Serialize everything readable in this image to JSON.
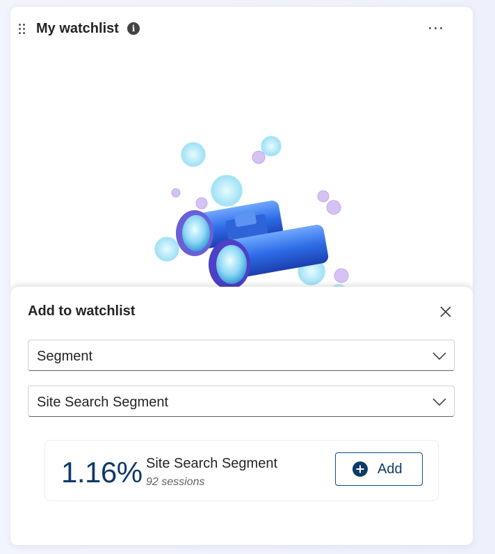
{
  "widget": {
    "title": "My watchlist",
    "info_icon": "info-icon",
    "more_icon": "more-horizontal-icon",
    "drag_icon": "drag-grip-icon",
    "illustration": "binoculars-snowflakes-illustration"
  },
  "panel": {
    "title": "Add to watchlist",
    "close_icon": "close-icon",
    "type_select": {
      "value": "Segment",
      "icon": "chevron-down-icon"
    },
    "item_select": {
      "value": "Site Search Segment",
      "icon": "chevron-down-icon"
    },
    "result": {
      "metric": "1.16%",
      "name": "Site Search Segment",
      "sessions": "92 sessions",
      "add_label": "Add",
      "add_icon": "plus-circle-icon"
    }
  },
  "colors": {
    "accent": "#0e3a66",
    "button_border": "#0e4e86",
    "background": "#eef1fb"
  }
}
